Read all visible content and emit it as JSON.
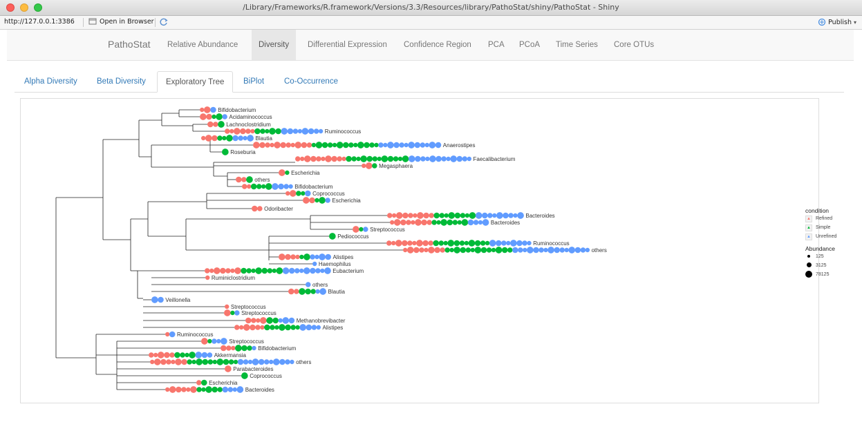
{
  "window": {
    "title": "/Library/Frameworks/R.framework/Versions/3.3/Resources/library/PathoStat/shiny/PathoStat - Shiny",
    "url": "http://127.0.0.1:3386",
    "open_in_browser": "Open in Browser",
    "publish": "Publish"
  },
  "navbar": {
    "brand": "PathoStat",
    "items": [
      "Relative Abundance",
      "Diversity",
      "Differential Expression",
      "Confidence Region",
      "PCA",
      "PCoA",
      "Time Series",
      "Core OTUs"
    ],
    "active": "Diversity"
  },
  "subtabs": {
    "items": [
      "Alpha Diversity",
      "Beta Diversity",
      "Exploratory Tree",
      "BiPlot",
      "Co-Occurrence"
    ],
    "active": "Exploratory Tree"
  },
  "legend": {
    "condition_title": "condition",
    "conditions": [
      {
        "label": "Refined",
        "color": "#f8766d"
      },
      {
        "label": "Simple",
        "color": "#00ba38"
      },
      {
        "label": "Unrefined",
        "color": "#619cff"
      }
    ],
    "abundance_title": "Abundance",
    "abundance": [
      "125",
      "3125",
      "78125"
    ]
  },
  "tree": {
    "tips": [
      {
        "label": "Bifidobacterium",
        "n": [
          2,
          0,
          1
        ]
      },
      {
        "label": "Acidaminococcus",
        "n": [
          2,
          2,
          1
        ]
      },
      {
        "label": "Lachnoclostridium",
        "n": [
          2,
          1,
          0
        ]
      },
      {
        "label": "Ruminococcus",
        "n": [
          6,
          5,
          8
        ]
      },
      {
        "label": "Blautia",
        "n": [
          3,
          3,
          4
        ]
      },
      {
        "label": "Anaerostipes",
        "n": [
          11,
          13,
          12
        ]
      },
      {
        "label": "Roseburia",
        "n": [
          0,
          1,
          0
        ]
      },
      {
        "label": "Faecalibacterium",
        "n": [
          10,
          12,
          12
        ]
      },
      {
        "label": "Megasphaera",
        "n": [
          2,
          1,
          0
        ]
      },
      {
        "label": "Escherichia",
        "n": [
          1,
          1,
          0
        ]
      },
      {
        "label": "others",
        "n": [
          2,
          1,
          0
        ]
      },
      {
        "label": "Bifidobacterium",
        "n": [
          2,
          4,
          4
        ]
      },
      {
        "label": "Coprococcus",
        "n": [
          2,
          2,
          1
        ]
      },
      {
        "label": "Escherichia",
        "n": [
          2,
          2,
          1
        ]
      },
      {
        "label": "Odoribacter",
        "n": [
          2,
          0,
          0
        ]
      },
      {
        "label": "Bacteroides",
        "n": [
          9,
          8,
          9
        ]
      },
      {
        "label": "Bacteroides",
        "n": [
          8,
          7,
          4
        ]
      },
      {
        "label": "Streptococcus",
        "n": [
          1,
          1,
          1
        ]
      },
      {
        "label": "Pediococcus",
        "n": [
          0,
          1,
          0
        ]
      },
      {
        "label": "Ruminococcus",
        "n": [
          9,
          11,
          8
        ]
      },
      {
        "label": "others",
        "n": [
          8,
          13,
          15
        ]
      },
      {
        "label": "Alistipes",
        "n": [
          4,
          2,
          4
        ]
      },
      {
        "label": "Haemophilus",
        "n": [
          0,
          0,
          1
        ]
      },
      {
        "label": "Eubacterium",
        "n": [
          7,
          8,
          9
        ]
      },
      {
        "label": "Ruminiclostridium",
        "n": [
          1,
          0,
          0
        ]
      },
      {
        "label": "others",
        "n": [
          0,
          0,
          1
        ]
      },
      {
        "label": "Blautia",
        "n": [
          2,
          3,
          2
        ]
      },
      {
        "label": "Veillonella",
        "n": [
          0,
          0,
          2
        ]
      },
      {
        "label": "Streptococcus",
        "n": [
          1,
          0,
          0
        ]
      },
      {
        "label": "Streptococcus",
        "n": [
          1,
          1,
          1
        ]
      },
      {
        "label": "Methanobrevibacter",
        "n": [
          4,
          2,
          3
        ]
      },
      {
        "label": "Alistipes",
        "n": [
          6,
          7,
          4
        ]
      },
      {
        "label": "Ruminococcus",
        "n": [
          1,
          0,
          1
        ]
      },
      {
        "label": "Streptococcus",
        "n": [
          1,
          1,
          3
        ]
      },
      {
        "label": "Bifidobacterium",
        "n": [
          3,
          3,
          1
        ]
      },
      {
        "label": "Akkermansia",
        "n": [
          5,
          4,
          3
        ]
      },
      {
        "label": "others",
        "n": [
          7,
          10,
          11
        ]
      },
      {
        "label": "Parabacteroides",
        "n": [
          1,
          0,
          0
        ]
      },
      {
        "label": "Coprococcus",
        "n": [
          0,
          1,
          0
        ]
      },
      {
        "label": "Escherichia",
        "n": [
          1,
          1,
          0
        ]
      },
      {
        "label": "Bacteroides",
        "n": [
          6,
          5,
          4
        ]
      }
    ]
  }
}
